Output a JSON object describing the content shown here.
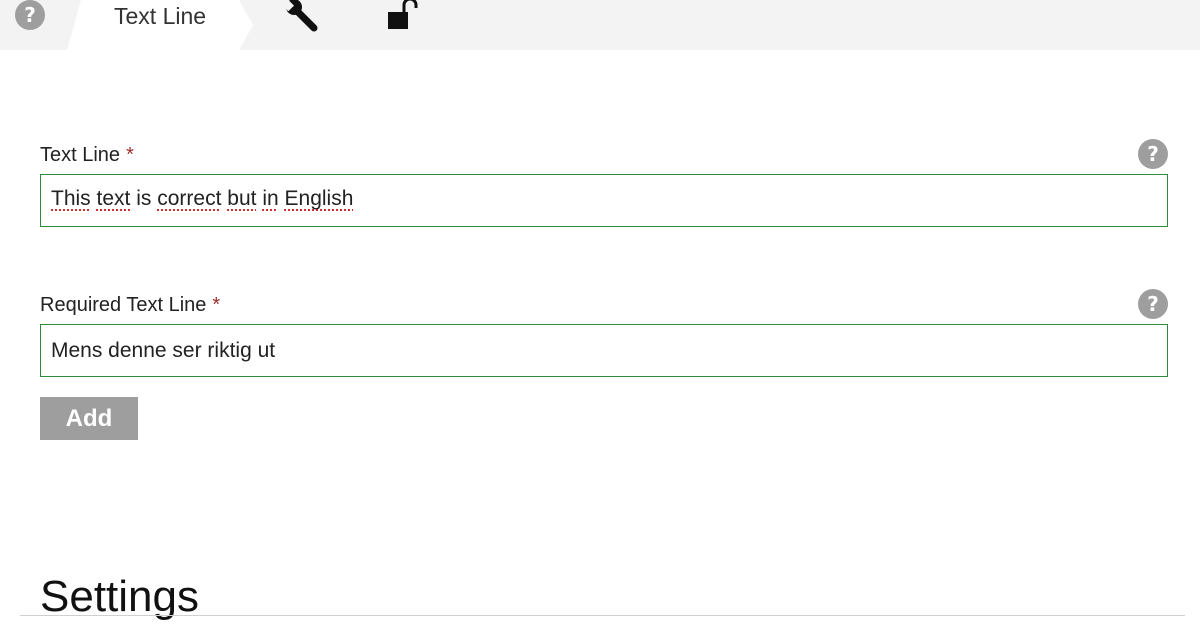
{
  "tabs": {
    "help_symbol": "?",
    "active_tab_label": "Text Line",
    "icons": [
      "wrench-icon",
      "lock-open-icon"
    ]
  },
  "fields": [
    {
      "label": "Text Line",
      "required_marker": "*",
      "value": "This text is correct but in English",
      "help_symbol": "?"
    },
    {
      "label": "Required Text Line",
      "required_marker": "*",
      "value": "Mens denne ser riktig ut",
      "help_symbol": "?"
    }
  ],
  "add_button_label": "Add",
  "settings_heading": "Settings",
  "colors": {
    "tabbar_bg": "#f3f3f3",
    "input_border": "#2e8b3e",
    "required_star": "#9b2d2d",
    "button_bg": "#9e9e9e",
    "help_icon": "#9e9e9e"
  }
}
